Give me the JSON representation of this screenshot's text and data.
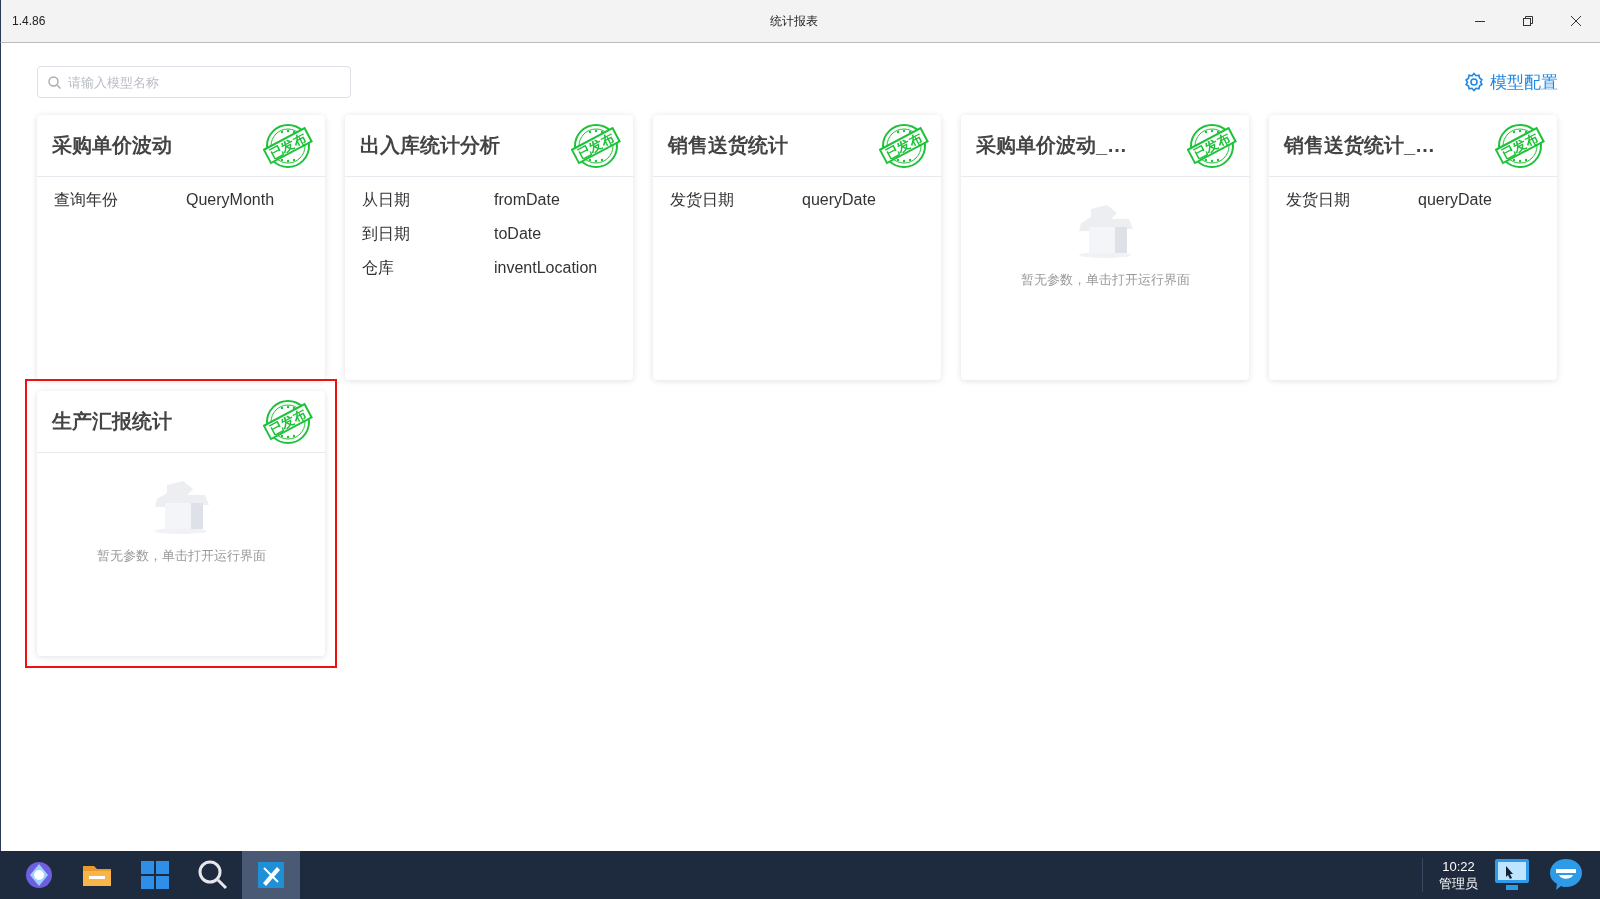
{
  "window": {
    "version": "1.4.86",
    "title": "统计报表"
  },
  "search": {
    "placeholder": "请输入模型名称"
  },
  "config_button": {
    "label": "模型配置"
  },
  "cards": [
    {
      "title": "采购单价波动",
      "stamp": "已发布",
      "highlighted": false,
      "params": [
        {
          "label": "查询年份",
          "field": "QueryMonth"
        }
      ]
    },
    {
      "title": "出入库统计分析",
      "stamp": "已发布",
      "highlighted": false,
      "params": [
        {
          "label": "从日期",
          "field": "fromDate"
        },
        {
          "label": "到日期",
          "field": "toDate"
        },
        {
          "label": "仓库",
          "field": "inventLocation"
        }
      ]
    },
    {
      "title": "销售送货统计",
      "stamp": "已发布",
      "highlighted": false,
      "params": [
        {
          "label": "发货日期",
          "field": "queryDate"
        }
      ]
    },
    {
      "title": "采购单价波动_…",
      "stamp": "已发布",
      "highlighted": false,
      "empty_text": "暂无参数，单击打开运行界面"
    },
    {
      "title": "销售送货统计_…",
      "stamp": "已发布",
      "highlighted": false,
      "params": [
        {
          "label": "发货日期",
          "field": "queryDate"
        }
      ]
    },
    {
      "title": "生产汇报统计",
      "stamp": "已发布",
      "highlighted": true,
      "empty_text": "暂无参数，单击打开运行界面"
    }
  ],
  "taskbar": {
    "apps": [
      {
        "kind": "launcher",
        "selected": false
      },
      {
        "kind": "files",
        "selected": false
      },
      {
        "kind": "start",
        "selected": false
      },
      {
        "kind": "search",
        "selected": false
      },
      {
        "kind": "design",
        "selected": true
      }
    ],
    "clock": "10:22",
    "user": "管理员"
  }
}
